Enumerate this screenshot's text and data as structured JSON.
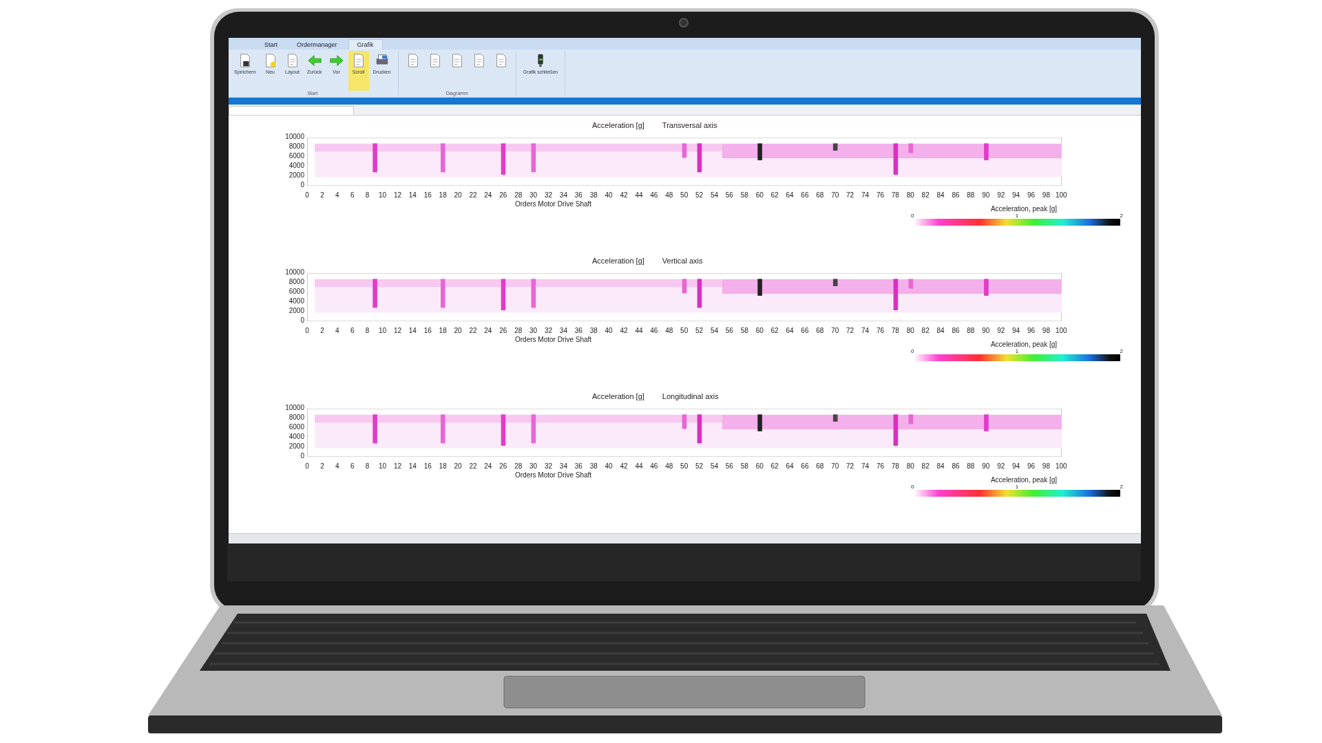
{
  "app": {
    "tabs": [
      {
        "label": "Start",
        "selected": false
      },
      {
        "label": "Ordermanager",
        "selected": false
      },
      {
        "label": "Grafik",
        "selected": true
      }
    ],
    "ribbon_groups": [
      {
        "label": "Start",
        "buttons": [
          {
            "label": "Speichern",
            "kind": "save",
            "selected": false
          },
          {
            "label": "Neu",
            "kind": "new",
            "selected": false
          },
          {
            "label": "Layout",
            "kind": "doc",
            "selected": false
          },
          {
            "label": "Zurück",
            "kind": "back",
            "selected": false
          },
          {
            "label": "Vor",
            "kind": "forward",
            "selected": false
          },
          {
            "label": "Scroll",
            "kind": "doc",
            "selected": true
          },
          {
            "label": "Drucken",
            "kind": "print",
            "selected": false
          }
        ]
      },
      {
        "label": "Diagramm",
        "buttons": [
          {
            "kind": "doc",
            "selected": false
          },
          {
            "kind": "doc",
            "selected": false
          },
          {
            "kind": "doc",
            "selected": false
          },
          {
            "kind": "doc",
            "selected": false
          },
          {
            "kind": "doc",
            "selected": false
          }
        ]
      },
      {
        "buttons": [
          {
            "label": "Grafik schließen",
            "kind": "close",
            "selected": false
          }
        ]
      }
    ],
    "charts": [
      {
        "title": "Acceleration [g]",
        "axis": "Transversal axis",
        "xlabel": "Orders Motor Drive Shaft",
        "yticks": [
          "10000",
          "8000",
          "6000",
          "4000",
          "2000",
          "0"
        ],
        "xticks": [
          "0",
          "2",
          "4",
          "6",
          "8",
          "10",
          "12",
          "14",
          "16",
          "18",
          "20",
          "22",
          "24",
          "26",
          "28",
          "30",
          "32",
          "34",
          "36",
          "38",
          "40",
          "42",
          "44",
          "46",
          "48",
          "50",
          "52",
          "54",
          "56",
          "58",
          "60",
          "62",
          "64",
          "66",
          "68",
          "70",
          "72",
          "74",
          "76",
          "78",
          "80",
          "82",
          "84",
          "86",
          "88",
          "90",
          "92",
          "94",
          "96",
          "98",
          "100"
        ],
        "colorbar": {
          "title": "Acceleration, peak [g]",
          "ticks": [
            "0",
            "1",
            "2"
          ]
        }
      },
      {
        "title": "Acceleration [g]",
        "axis": "Vertical axis",
        "xlabel": "Orders Motor Drive Shaft",
        "yticks": [
          "10000",
          "8000",
          "6000",
          "4000",
          "2000",
          "0"
        ],
        "xticks": [
          "0",
          "2",
          "4",
          "6",
          "8",
          "10",
          "12",
          "14",
          "16",
          "18",
          "20",
          "22",
          "24",
          "26",
          "28",
          "30",
          "32",
          "34",
          "36",
          "38",
          "40",
          "42",
          "44",
          "46",
          "48",
          "50",
          "52",
          "54",
          "56",
          "58",
          "60",
          "62",
          "64",
          "66",
          "68",
          "70",
          "72",
          "74",
          "76",
          "78",
          "80",
          "82",
          "84",
          "86",
          "88",
          "90",
          "92",
          "94",
          "96",
          "98",
          "100"
        ],
        "colorbar": {
          "title": "Acceleration, peak [g]",
          "ticks": [
            "0",
            "1",
            "2"
          ]
        }
      },
      {
        "title": "Acceleration [g]",
        "axis": "Longitudinal axis",
        "xlabel": "Orders Motor Drive Shaft",
        "yticks": [
          "10000",
          "8000",
          "6000",
          "4000",
          "2000",
          "0"
        ],
        "xticks": [
          "0",
          "2",
          "4",
          "6",
          "8",
          "10",
          "12",
          "14",
          "16",
          "18",
          "20",
          "22",
          "24",
          "26",
          "28",
          "30",
          "32",
          "34",
          "36",
          "38",
          "40",
          "42",
          "44",
          "46",
          "48",
          "50",
          "52",
          "54",
          "56",
          "58",
          "60",
          "62",
          "64",
          "66",
          "68",
          "70",
          "72",
          "74",
          "76",
          "78",
          "80",
          "82",
          "84",
          "86",
          "88",
          "90",
          "92",
          "94",
          "96",
          "98",
          "100"
        ],
        "colorbar": {
          "title": "Acceleration, peak [g]",
          "ticks": [
            "0",
            "1",
            "2"
          ]
        }
      }
    ]
  }
}
